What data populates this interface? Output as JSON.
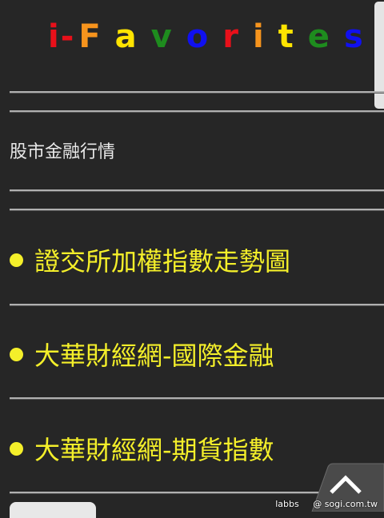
{
  "header": {
    "logo_letters": [
      {
        "char": "i",
        "color": "#e8101a"
      },
      {
        "char": "-",
        "color": "#e8101a"
      },
      {
        "char": "F",
        "color": "#f7941d"
      },
      {
        "char": "a",
        "color": "#ffe400"
      },
      {
        "char": "v",
        "color": "#1e8c1e"
      },
      {
        "char": "o",
        "color": "#1010f0"
      },
      {
        "char": "r",
        "color": "#e8101a"
      },
      {
        "char": "i",
        "color": "#f7941d"
      },
      {
        "char": "t",
        "color": "#ffe400"
      },
      {
        "char": "e",
        "color": "#1e8c1e"
      },
      {
        "char": "s",
        "color": "#1010f0"
      }
    ]
  },
  "section": {
    "title": "股市金融行情"
  },
  "links": [
    {
      "label": "證交所加權指數走勢圖"
    },
    {
      "label": "大華財經網-國際金融"
    },
    {
      "label": "大華財經網-期貨指數"
    }
  ],
  "footer": {
    "watermark_left": "labbs",
    "watermark_right": "@ sogi.com.tw",
    "top_button_icon": "chevron-up-icon"
  },
  "colors": {
    "background": "#262626",
    "link": "#f4ef2a",
    "section_title": "#e8e8e8"
  }
}
